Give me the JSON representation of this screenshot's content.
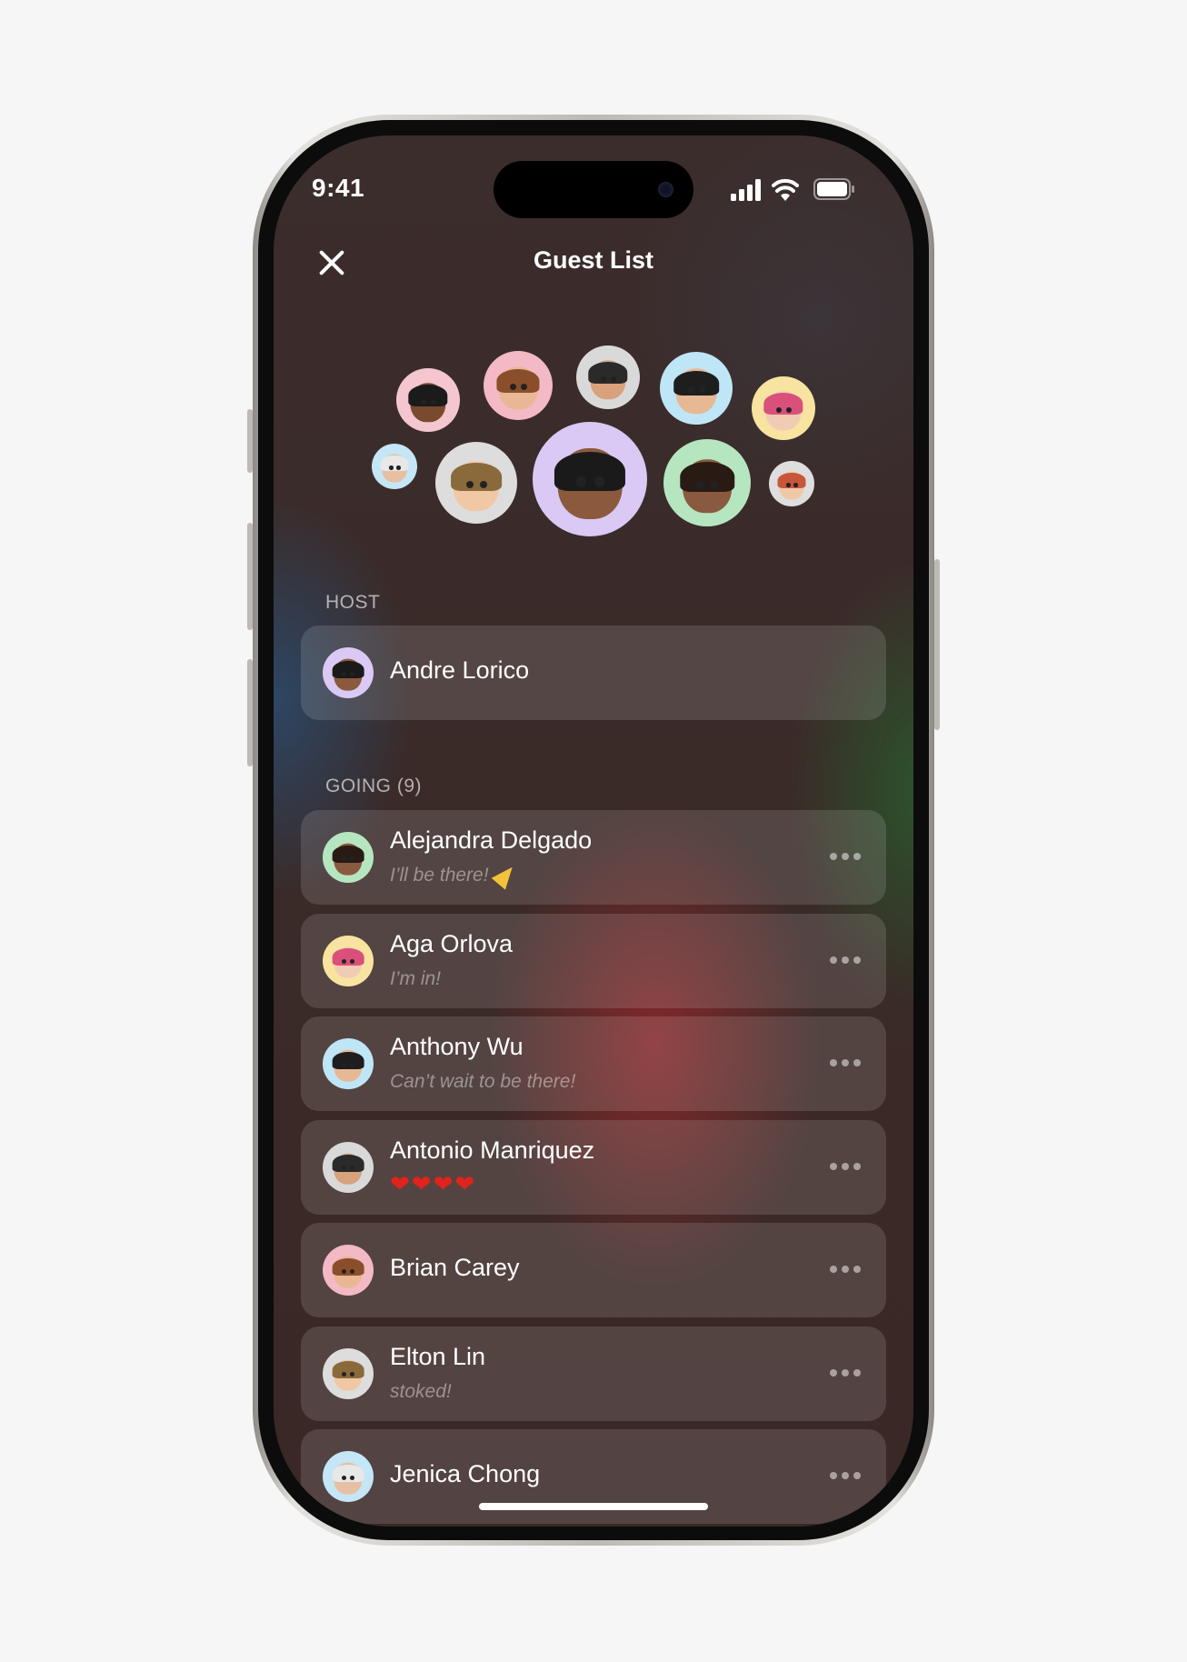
{
  "status_bar": {
    "time": "9:41",
    "icons": [
      "cellular-signal-icon",
      "wifi-icon",
      "battery-icon"
    ]
  },
  "header": {
    "title": "Guest List",
    "close_icon": "close-icon"
  },
  "avatar_cluster": [
    {
      "bg": "#f4c6d0",
      "skin": "#7a4a2e",
      "hair": "#1b1b1b"
    },
    {
      "bg": "#f3b9c4",
      "skin": "#e9b796",
      "hair": "#8a4f2a"
    },
    {
      "bg": "#d9d9d9",
      "skin": "#d8a27c",
      "hair": "#2a2a2a"
    },
    {
      "bg": "#bfe6f7",
      "skin": "#e6b894",
      "hair": "#1e1e1e"
    },
    {
      "bg": "#f8e3a0",
      "skin": "#f1cbb4",
      "hair": "#d9507a"
    },
    {
      "bg": "#c4e6f6",
      "skin": "#e7c0a4",
      "hair": "#e8e8e8"
    },
    {
      "bg": "#dddddd",
      "skin": "#f0c8a4",
      "hair": "#8a6a3a"
    },
    {
      "bg": "#d9c9f4",
      "skin": "#8b5a3c",
      "hair": "#1a1a1a"
    },
    {
      "bg": "#b6e6c0",
      "skin": "#8a5a40",
      "hair": "#2a1a14"
    },
    {
      "bg": "#dedede",
      "skin": "#f0c8a8",
      "hair": "#c8563a"
    }
  ],
  "host": {
    "label": "HOST",
    "name": "Andre Lorico",
    "avatar_bg": "#d9c9f4",
    "skin": "#8b5a3c",
    "hair": "#1a1a1a"
  },
  "going": {
    "label": "GOING (9)",
    "guests": [
      {
        "name": "Alejandra Delgado",
        "status": "I’ll be there!",
        "status_icon": "party-popper-icon",
        "avatar_bg": "#b6e6c0",
        "skin": "#8a5a40",
        "hair": "#2a1a14"
      },
      {
        "name": "Aga Orlova",
        "status": "I’m in!",
        "avatar_bg": "#f8e3a0",
        "skin": "#f1cbb4",
        "hair": "#d9507a"
      },
      {
        "name": "Anthony Wu",
        "status": "Can’t wait to be there!",
        "avatar_bg": "#bfe6f7",
        "skin": "#e6b894",
        "hair": "#1e1e1e"
      },
      {
        "name": "Antonio Manriquez",
        "status": "❤❤❤❤",
        "avatar_bg": "#d9d9d9",
        "skin": "#d8a27c",
        "hair": "#2a2a2a"
      },
      {
        "name": "Brian Carey",
        "status": "",
        "avatar_bg": "#f3b9c4",
        "skin": "#e9b796",
        "hair": "#8a4f2a"
      },
      {
        "name": "Elton Lin",
        "status": "stoked!",
        "avatar_bg": "#dddddd",
        "skin": "#f0c8a4",
        "hair": "#8a6a3a"
      },
      {
        "name": "Jenica Chong",
        "status": "",
        "avatar_bg": "#c4e6f6",
        "skin": "#e7c0a4",
        "hair": "#e8e8e8"
      }
    ],
    "more_icon": "more-options-icon"
  }
}
